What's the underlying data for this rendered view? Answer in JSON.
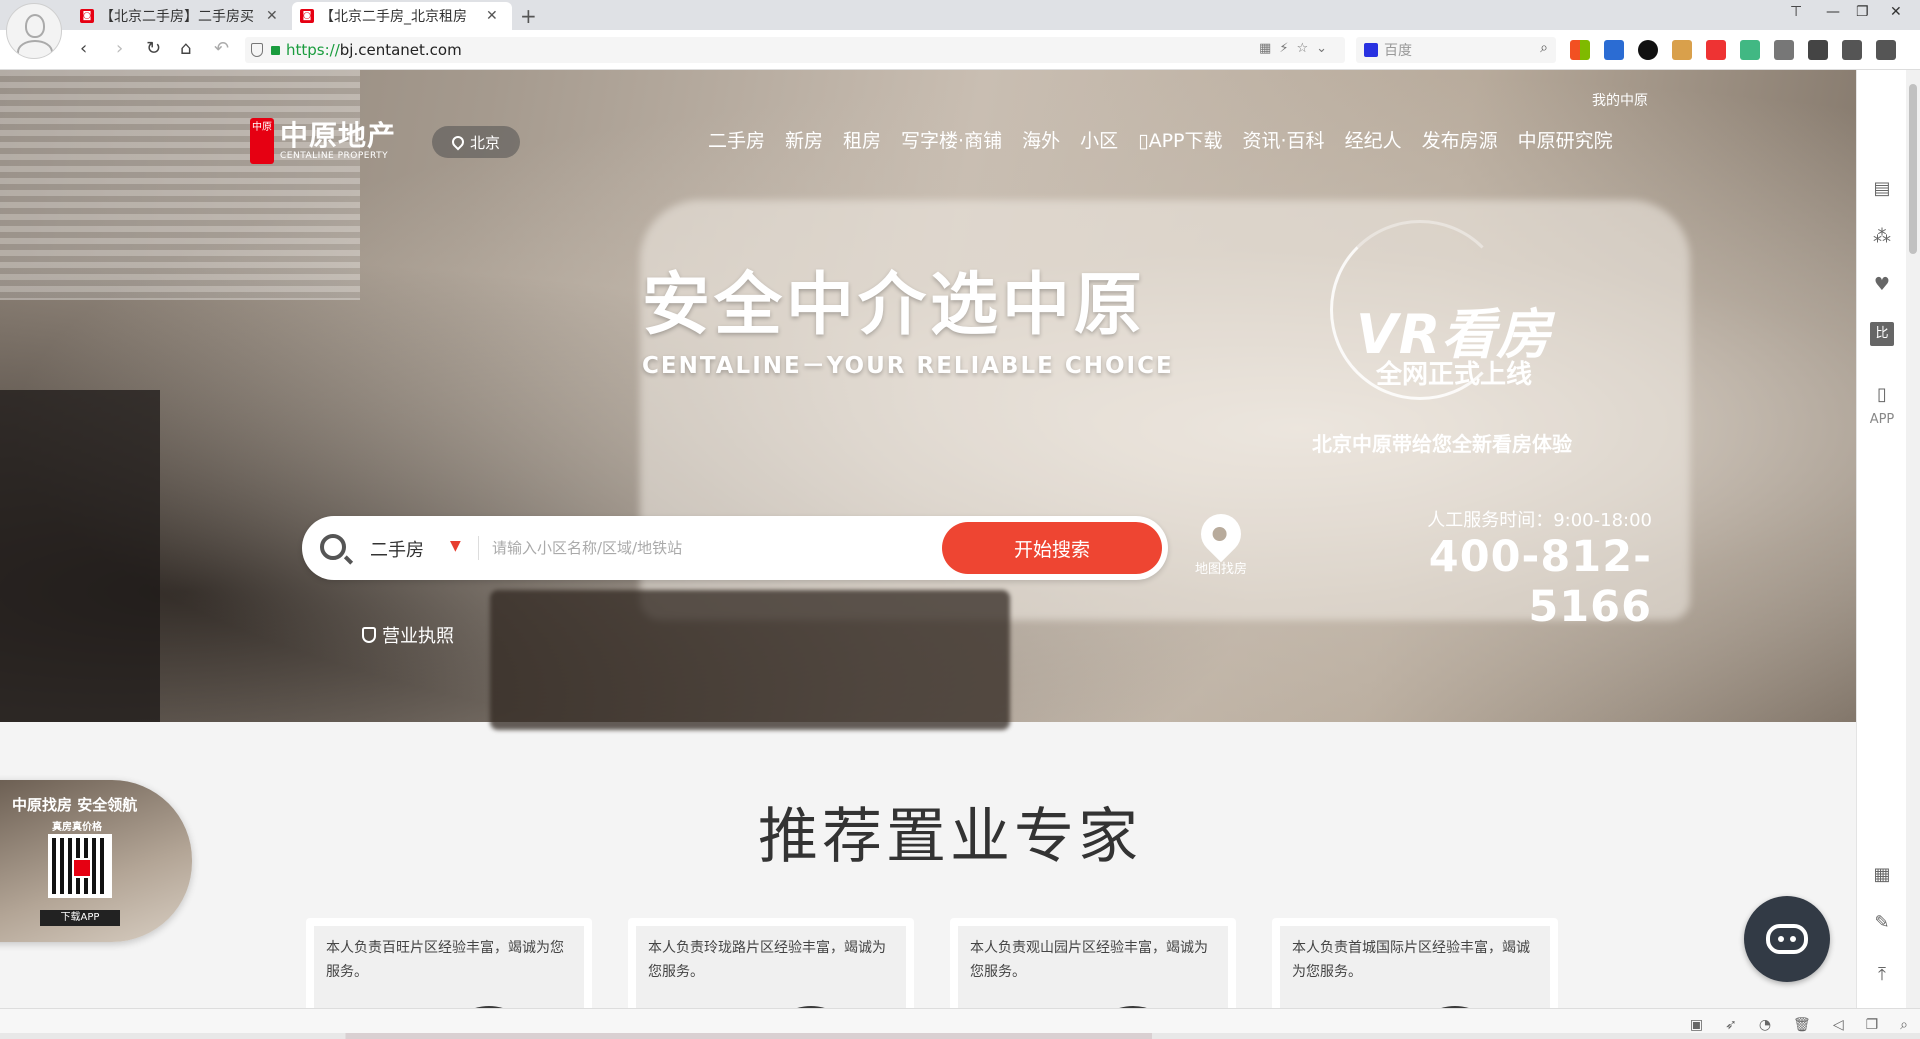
{
  "browser": {
    "tabs": [
      {
        "label": "【北京二手房】二手房买",
        "active": false
      },
      {
        "label": "【北京二手房_北京租房",
        "active": true
      }
    ],
    "new_tab": "+",
    "url_scheme": "https://",
    "url_host": "bj.centanet.com",
    "search_engine_placeholder": "百度"
  },
  "header": {
    "logo_zh": "中原地产",
    "logo_en": "CENTALINE PROPERTY",
    "logo_seal": "中原",
    "city": "北京",
    "my_center": "我的中原",
    "nav": [
      "二手房",
      "新房",
      "租房",
      "写字楼·商铺",
      "海外",
      "小区",
      "APP下载",
      "资讯·百科",
      "经纪人",
      "发布房源",
      "中原研究院"
    ]
  },
  "hero": {
    "slogan": "安全中介选中原",
    "slogan_en": "CENTALINE－YOUR RELIABLE CHOICE",
    "vr_title": "VR看房",
    "vr_subtitle": "全网正式上线",
    "vr_desc": "北京中原带给您全新看房体验",
    "service_hours": "人工服务时间：9:00-18:00",
    "phone": "400-812-5166",
    "license": "营业执照",
    "map_find": "地图找房"
  },
  "search": {
    "type": "二手房",
    "placeholder": "请输入小区名称/区域/地铁站",
    "button": "开始搜索"
  },
  "qr_promo": {
    "line1": "中原找房  安全领航",
    "line2": "真房真价格",
    "download": "下载APP"
  },
  "section": {
    "title": "推荐置业专家"
  },
  "experts": [
    {
      "desc": "本人负责百旺片区经验丰富，竭诚为您服务。"
    },
    {
      "desc": "本人负责玲珑路片区经验丰富，竭诚为您服务。"
    },
    {
      "desc": "本人负责观山园片区经验丰富，竭诚为您服务。"
    },
    {
      "desc": "本人负责首城国际片区经验丰富，竭诚为您服务。"
    }
  ],
  "sidebar": {
    "app_label": "APP",
    "compare_label": "比"
  },
  "colors": {
    "brand_red": "#e60012",
    "search_button": "#ee4532"
  }
}
